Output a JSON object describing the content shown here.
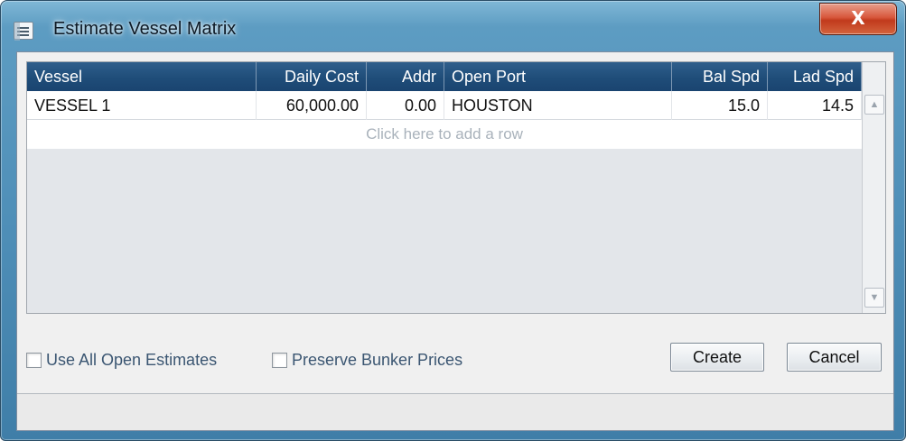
{
  "window": {
    "title": "Estimate Vessel Matrix",
    "close_label": "X",
    "title_icon": "document-list-icon"
  },
  "grid": {
    "columns": [
      "Vessel",
      "Daily Cost",
      "Addr",
      "Open Port",
      "Bal Spd",
      "Lad Spd"
    ],
    "rows": [
      [
        "VESSEL 1",
        "60,000.00",
        "0.00",
        "HOUSTON",
        "15.0",
        "14.5"
      ]
    ],
    "add_row_hint": "Click here to add a row",
    "scroll_up_glyph": "▲",
    "scroll_down_glyph": "▼"
  },
  "options": {
    "use_all_open_estimates": {
      "label": "Use All Open Estimates",
      "checked": false
    },
    "preserve_bunker_prices": {
      "label": "Preserve Bunker Prices",
      "checked": false
    }
  },
  "buttons": {
    "create": "Create",
    "cancel": "Cancel"
  },
  "colors": {
    "header_bg": "#1f4d79",
    "title_bar": "#4f8fb8",
    "close_button": "#c13a1c",
    "option_label": "#3b5672"
  }
}
